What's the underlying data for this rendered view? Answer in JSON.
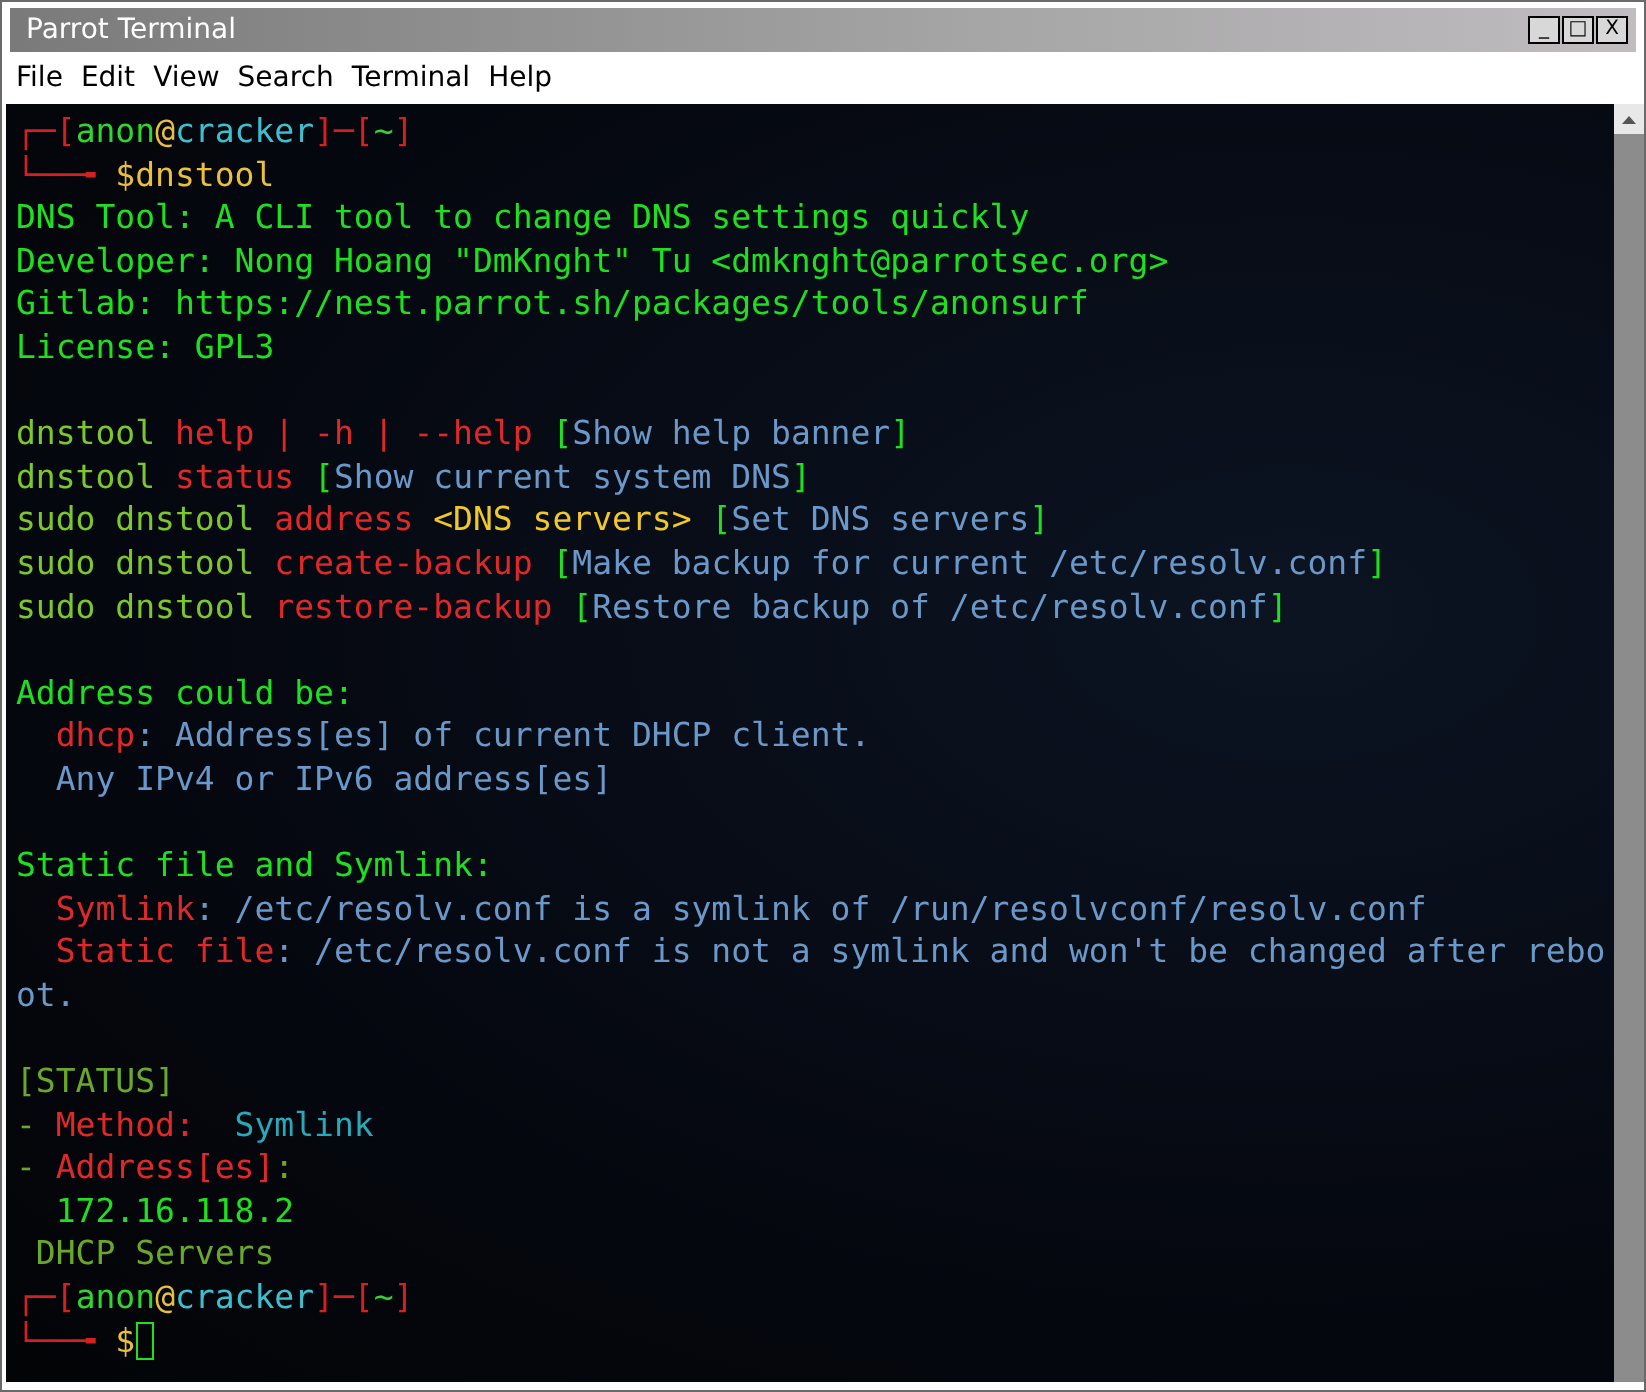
{
  "window": {
    "title": "Parrot Terminal",
    "controls": [
      "_",
      "□",
      "X"
    ]
  },
  "menu": [
    "File",
    "Edit",
    "View",
    "Search",
    "Terminal",
    "Help"
  ],
  "blocks": [
    {
      "lines": [
        {
          "segments": [
            {
              "text": "┌─[",
              "color": "#d42020"
            },
            {
              "text": "anon",
              "color": "#2ed62e"
            },
            {
              "text": "@",
              "color": "#e8c03a"
            },
            {
              "text": "cracker",
              "color": "#3cc0d0"
            },
            {
              "text": "]─[",
              "color": "#d42020"
            },
            {
              "text": "~",
              "color": "#2ed62e"
            },
            {
              "text": "]",
              "color": "#d42020"
            }
          ]
        },
        {
          "segments": [
            {
              "text": "└──╼ ",
              "color": "#d42020"
            },
            {
              "text": "$dnstool",
              "color": "#e8c03a"
            }
          ]
        },
        {
          "segments": [
            {
              "text": "DNS Tool: A CLI tool to change DNS settings quickly",
              "color": "#1ee01e"
            }
          ]
        },
        {
          "segments": [
            {
              "text": "Developer: Nong Hoang \"DmKnght\" Tu <dmknght@parrotsec.org>",
              "color": "#1ee01e"
            }
          ]
        },
        {
          "segments": [
            {
              "text": "Gitlab: https://nest.parrot.sh/packages/tools/anonsurf",
              "color": "#1ee01e"
            }
          ]
        },
        {
          "segments": [
            {
              "text": "License: GPL3",
              "color": "#1ee01e"
            }
          ]
        }
      ]
    },
    {
      "lines": [
        {
          "segments": [
            {
              "text": "dnstool ",
              "color": "#7cc82c"
            },
            {
              "text": "help | -h | --help ",
              "color": "#e02828"
            },
            {
              "text": "[",
              "color": "#1ee01e"
            },
            {
              "text": "Show help banner",
              "color": "#6a98c8"
            },
            {
              "text": "]",
              "color": "#1ee01e"
            }
          ]
        },
        {
          "segments": [
            {
              "text": "dnstool ",
              "color": "#7cc82c"
            },
            {
              "text": "status ",
              "color": "#e02828"
            },
            {
              "text": "[",
              "color": "#1ee01e"
            },
            {
              "text": "Show current system DNS",
              "color": "#6a98c8"
            },
            {
              "text": "]",
              "color": "#1ee01e"
            }
          ]
        },
        {
          "segments": [
            {
              "text": "sudo dnstool ",
              "color": "#7cc82c"
            },
            {
              "text": "address ",
              "color": "#e02828"
            },
            {
              "text": "<DNS servers> ",
              "color": "#f0c828"
            },
            {
              "text": "[",
              "color": "#1ee01e"
            },
            {
              "text": "Set DNS servers",
              "color": "#6a98c8"
            },
            {
              "text": "]",
              "color": "#1ee01e"
            }
          ]
        },
        {
          "segments": [
            {
              "text": "sudo dnstool ",
              "color": "#7cc82c"
            },
            {
              "text": "create-backup ",
              "color": "#e02828"
            },
            {
              "text": "[",
              "color": "#1ee01e"
            },
            {
              "text": "Make backup for current /etc/resolv.conf",
              "color": "#6a98c8"
            },
            {
              "text": "]",
              "color": "#1ee01e"
            }
          ]
        },
        {
          "segments": [
            {
              "text": "sudo dnstool ",
              "color": "#7cc82c"
            },
            {
              "text": "restore-backup ",
              "color": "#e02828"
            },
            {
              "text": "[",
              "color": "#1ee01e"
            },
            {
              "text": "Restore backup of /etc/resolv.conf",
              "color": "#6a98c8"
            },
            {
              "text": "]",
              "color": "#1ee01e"
            }
          ]
        }
      ]
    },
    {
      "lines": [
        {
          "segments": [
            {
              "text": "Address could be:",
              "color": "#1ee01e"
            }
          ]
        },
        {
          "segments": [
            {
              "text": "  dhcp",
              "color": "#e02828"
            },
            {
              "text": ": Address[es] of current DHCP client.",
              "color": "#6a98c8"
            }
          ]
        },
        {
          "segments": [
            {
              "text": "  Any IPv4 or IPv6 address[es]",
              "color": "#6a98c8"
            }
          ]
        }
      ]
    },
    {
      "lines": [
        {
          "segments": [
            {
              "text": "Static file and Symlink:",
              "color": "#1ee01e"
            }
          ]
        },
        {
          "segments": [
            {
              "text": "  Symlink",
              "color": "#e02828"
            },
            {
              "text": ": /etc/resolv.conf is a symlink of /run/resolvconf/resolv.conf",
              "color": "#6a98c8"
            }
          ]
        },
        {
          "segments": [
            {
              "text": "  Static file",
              "color": "#e02828"
            },
            {
              "text": ": /etc/resolv.conf is not a symlink and won't be changed after rebo",
              "color": "#6a98c8"
            }
          ]
        },
        {
          "segments": [
            {
              "text": "ot.",
              "color": "#6a98c8"
            }
          ]
        }
      ]
    },
    {
      "lines": [
        {
          "segments": [
            {
              "text": "[STATUS]",
              "color": "#6aa82a"
            }
          ]
        },
        {
          "segments": [
            {
              "text": "- ",
              "color": "#6aa82a"
            },
            {
              "text": "Method:  ",
              "color": "#e02828"
            },
            {
              "text": "Symlink",
              "color": "#2aa8b8"
            }
          ]
        },
        {
          "segments": [
            {
              "text": "- ",
              "color": "#6aa82a"
            },
            {
              "text": "Address[es]",
              "color": "#e02828"
            },
            {
              "text": ":",
              "color": "#6aa82a"
            }
          ]
        },
        {
          "segments": [
            {
              "text": "  172.16.118.2",
              "color": "#1ee01e"
            }
          ]
        },
        {
          "segments": [
            {
              "text": " DHCP Servers",
              "color": "#6aa82a"
            }
          ]
        },
        {
          "segments": [
            {
              "text": "┌─[",
              "color": "#d42020"
            },
            {
              "text": "anon",
              "color": "#2ed62e"
            },
            {
              "text": "@",
              "color": "#e8c03a"
            },
            {
              "text": "cracker",
              "color": "#3cc0d0"
            },
            {
              "text": "]─[",
              "color": "#d42020"
            },
            {
              "text": "~",
              "color": "#2ed62e"
            },
            {
              "text": "]",
              "color": "#d42020"
            }
          ]
        },
        {
          "segments": [
            {
              "text": "└──╼ ",
              "color": "#d42020"
            },
            {
              "text": "$",
              "color": "#e8c03a"
            }
          ],
          "cursor": true
        }
      ]
    }
  ]
}
